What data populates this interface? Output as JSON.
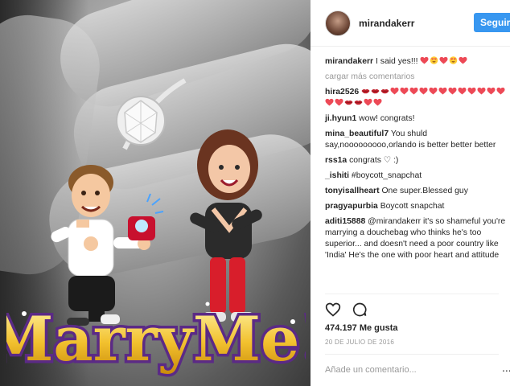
{
  "post": {
    "username": "mirandakerr",
    "follow_label": "Seguir"
  },
  "caption": {
    "user": "mirandakerr",
    "text": "I said yes!!!",
    "emojis": [
      "heart",
      "heart-eyes",
      "heart",
      "heart-eyes",
      "heart"
    ]
  },
  "load_more": "cargar más comentarios",
  "comments": [
    {
      "user": "hira2526",
      "text": "",
      "emojis": [
        "lips",
        "lips",
        "lips",
        "heart",
        "heart",
        "heart",
        "heart",
        "heart",
        "heart",
        "heart",
        "heart",
        "heart",
        "heart",
        "heart",
        "heart",
        "heart",
        "heart",
        "lips",
        "lips",
        "heart",
        "heart"
      ]
    },
    {
      "user": "ji.hyun1",
      "text": "wow! congrats!"
    },
    {
      "user": "mina_beautiful7",
      "text": "You shuld say,nooooooooo,orlando is better better better"
    },
    {
      "user": "rss1a",
      "text": "congrats ♡ :)"
    },
    {
      "user": "_ishiti",
      "text": "#boycott_snapchat"
    },
    {
      "user": "tonyisallheart",
      "text": "One super.Blessed guy"
    },
    {
      "user": "pragyapurbia",
      "text": "Boycott snapchat"
    },
    {
      "user": "aditi15888",
      "text": "@mirandakerr it's so shameful you're marrying a douchebag who thinks he's too superior... and doesn't need a poor country like 'India' He's the one with poor heart and attitude"
    }
  ],
  "actions": {
    "like_icon": "heart-outline-icon",
    "comment_icon": "comment-bubble-icon"
  },
  "likes": "474.197 Me gusta",
  "date": "20 DE JULIO DE 2016",
  "add_comment_placeholder": "Añade un comentario...",
  "more_options": "...",
  "photo": {
    "overlay_text": "MarryMe!"
  },
  "colors": {
    "accent": "#3897f0",
    "heart": "#ed4956",
    "lips": "#c0202c",
    "muted": "#999999",
    "gold": "#f2c12e"
  }
}
